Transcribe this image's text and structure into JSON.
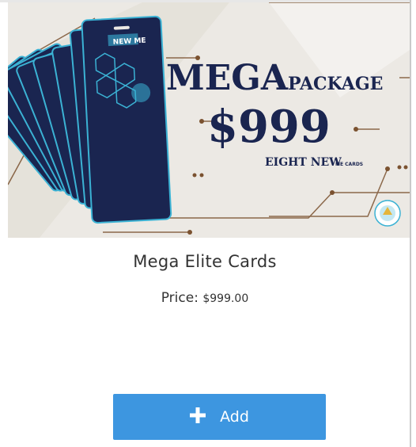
{
  "product": {
    "banner": {
      "badge_text": "NEW ME",
      "headline_main": "MEGA",
      "headline_sub": "PACKAGE",
      "price_text": "$999",
      "tagline_main": "EIGHT NEW",
      "tagline_small": "ME CARDS",
      "colors": {
        "background": "#ece9e4",
        "navy": "#1a2550",
        "cyan": "#3bb2d4",
        "circuit": "#7b5230"
      }
    },
    "name": "Mega Elite Cards",
    "price_label": "Price:",
    "price_value": "$999.00"
  },
  "actions": {
    "add_label": "Add",
    "add_icon": "plus-icon",
    "accent": "#3d96e0"
  }
}
